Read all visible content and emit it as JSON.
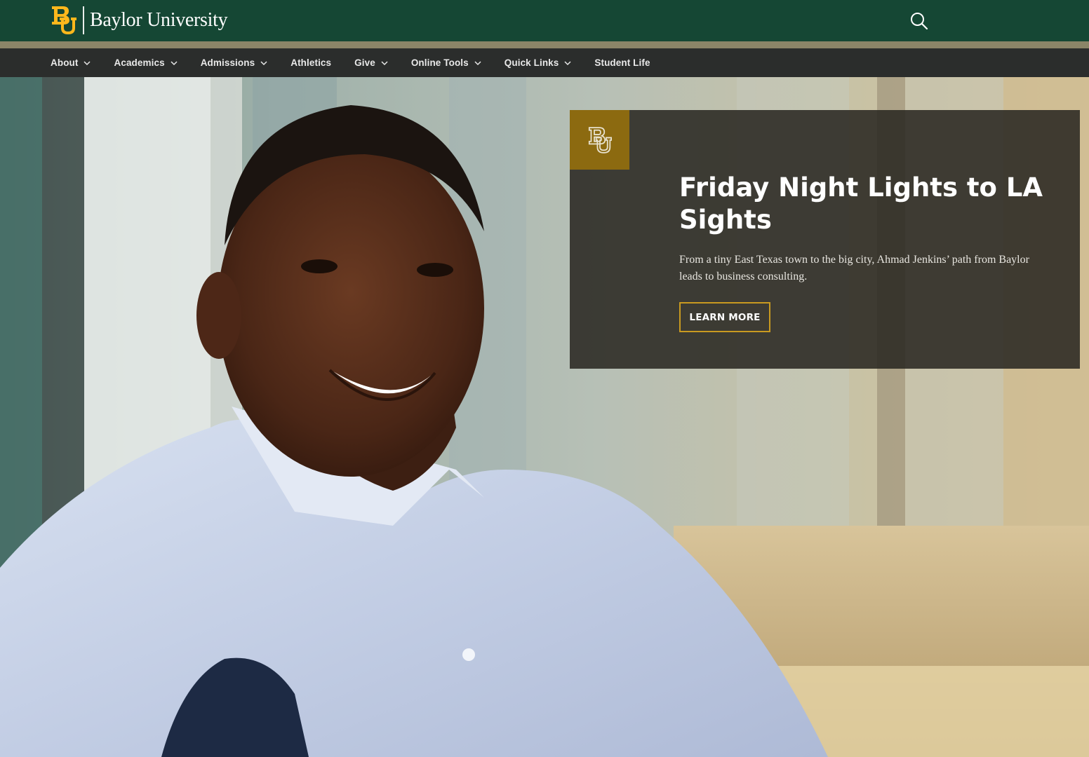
{
  "brand": {
    "name": "Baylor University",
    "logo_icon": "baylor-bu-monogram",
    "color_green": "#154734",
    "color_gold": "#FFB81C"
  },
  "header": {
    "search_icon": "search-icon"
  },
  "nav": {
    "items": [
      {
        "label": "About",
        "dropdown": true
      },
      {
        "label": "Academics",
        "dropdown": true
      },
      {
        "label": "Admissions",
        "dropdown": true
      },
      {
        "label": "Athletics",
        "dropdown": false
      },
      {
        "label": "Give",
        "dropdown": true
      },
      {
        "label": "Online Tools",
        "dropdown": true
      },
      {
        "label": "Quick Links",
        "dropdown": true
      },
      {
        "label": "Student Life",
        "dropdown": false
      }
    ]
  },
  "hero": {
    "image": "photo-of-smiling-man-in-light-blue-shirt-by-office-window",
    "story": {
      "badge_icon": "baylor-bu-monogram",
      "title": "Friday Night Lights to LA Sights",
      "description": "From a tiny East Texas town to the big city, Ahmad Jenkins’ path from Baylor leads to business consulting.",
      "button_label": "LEARN MORE"
    }
  }
}
